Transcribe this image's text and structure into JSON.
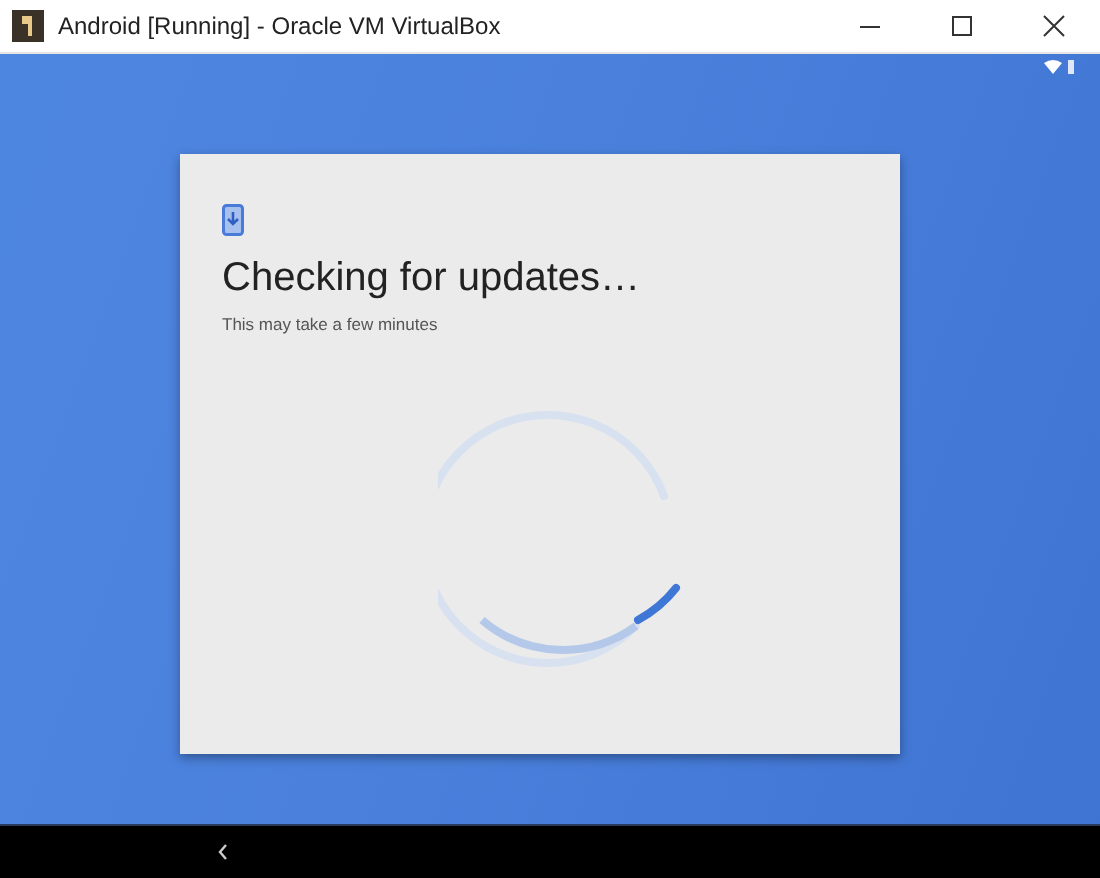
{
  "window": {
    "title": "Android [Running] - Oracle VM VirtualBox"
  },
  "dialog": {
    "title": "Checking for updates…",
    "subtitle": "This may take a few minutes"
  }
}
